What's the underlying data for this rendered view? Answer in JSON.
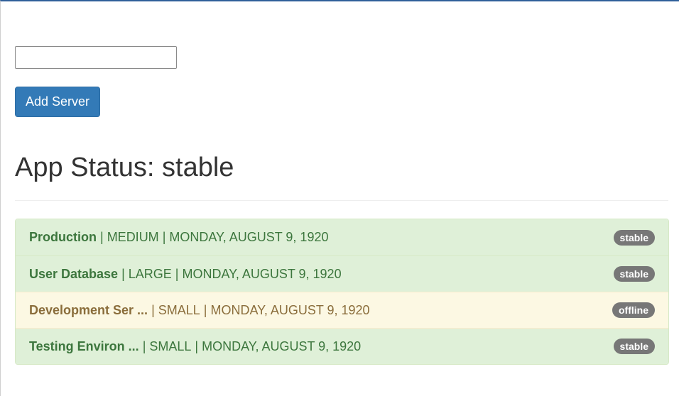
{
  "form": {
    "input_value": "",
    "input_placeholder": "",
    "add_button_label": "Add Server"
  },
  "app_status": {
    "title": "App Status: stable"
  },
  "servers": [
    {
      "name": "Production",
      "size": "MEDIUM",
      "date": "MONDAY, AUGUST 9, 1920",
      "status": "stable",
      "row_style": "success"
    },
    {
      "name": "User Database",
      "size": "LARGE",
      "date": "MONDAY, AUGUST 9, 1920",
      "status": "stable",
      "row_style": "success"
    },
    {
      "name": "Development Ser ...",
      "size": "SMALL",
      "date": "MONDAY, AUGUST 9, 1920",
      "status": "offline",
      "row_style": "warning"
    },
    {
      "name": "Testing Environ ...",
      "size": "SMALL",
      "date": "MONDAY, AUGUST 9, 1920",
      "status": "stable",
      "row_style": "success"
    }
  ],
  "separator": "|",
  "colors": {
    "primary_button": "#337ab7",
    "success_bg": "#dff0d8",
    "success_text": "#3c763d",
    "warning_bg": "#fcf8e3",
    "warning_text": "#8a6d3b",
    "badge_bg": "#777777",
    "top_bar": "#2f5f9a"
  }
}
